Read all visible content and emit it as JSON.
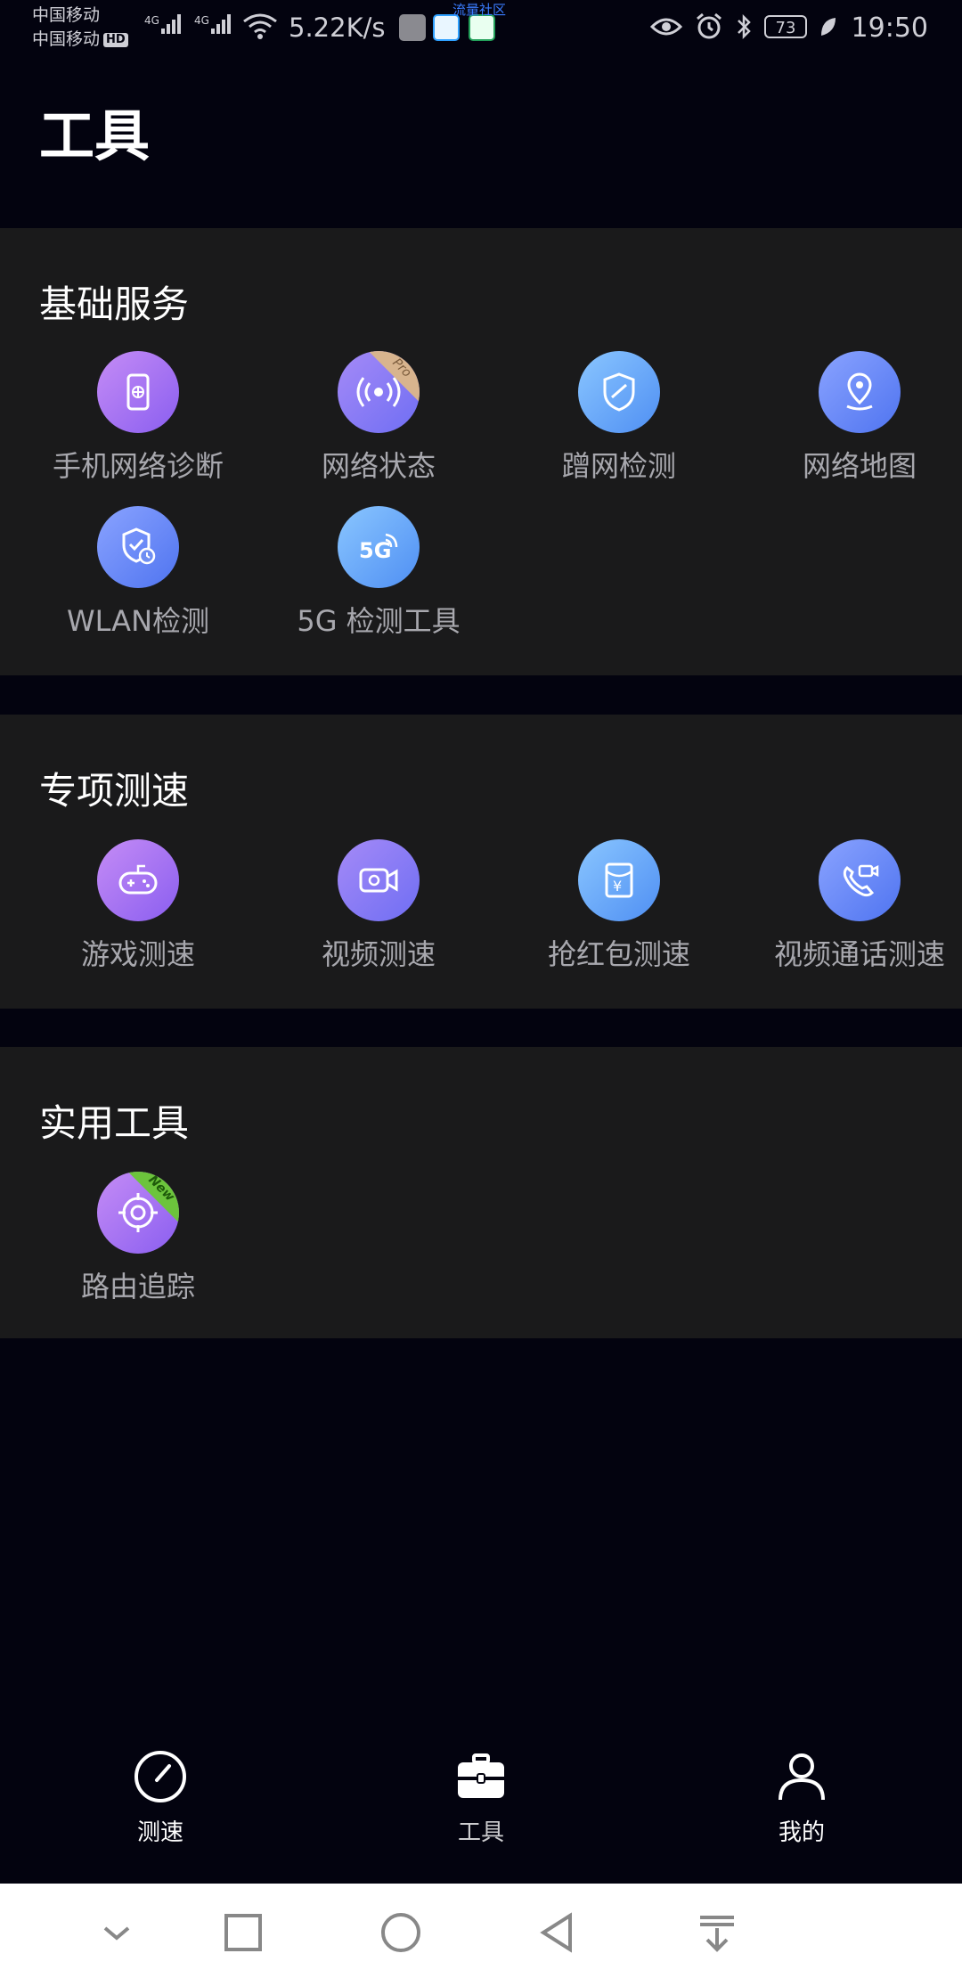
{
  "status_bar": {
    "carrier_1": "中国移动",
    "carrier_2": "中国移动",
    "hd": "HD",
    "sig_tag": "4G",
    "net_speed": "5.22K/s",
    "community": "流量社区",
    "battery": "73",
    "time": "19:50"
  },
  "page": {
    "title": "工具"
  },
  "sections": [
    {
      "title": "基础服务",
      "items": [
        {
          "label": "手机网络诊断",
          "icon": "phone-network-icon"
        },
        {
          "label": "网络状态",
          "icon": "signal-icon",
          "badge": "Pro"
        },
        {
          "label": "蹭网检测",
          "icon": "shield-icon"
        },
        {
          "label": "网络地图",
          "icon": "map-pin-icon"
        },
        {
          "label": "WLAN检测",
          "icon": "shield-check-icon"
        },
        {
          "label": "5G 检测工具",
          "icon": "5g-icon",
          "icon_text": "5G"
        }
      ]
    },
    {
      "title": "专项测速",
      "items": [
        {
          "label": "游戏测速",
          "icon": "gamepad-icon"
        },
        {
          "label": "视频测速",
          "icon": "video-camera-icon"
        },
        {
          "label": "抢红包测速",
          "icon": "red-envelope-icon",
          "icon_text": "¥"
        },
        {
          "label": "视频通话测速",
          "icon": "video-call-icon"
        }
      ]
    },
    {
      "title": "实用工具",
      "items": [
        {
          "label": "路由追踪",
          "icon": "route-trace-icon",
          "badge": "New"
        }
      ]
    }
  ],
  "tabs": [
    {
      "label": "测速",
      "icon": "speedometer-icon"
    },
    {
      "label": "工具",
      "icon": "toolbox-icon"
    },
    {
      "label": "我的",
      "icon": "user-icon"
    }
  ],
  "colors": {
    "background": "#03030f",
    "section_bg": "#1a1a1b",
    "label": "#a8a8ae"
  }
}
